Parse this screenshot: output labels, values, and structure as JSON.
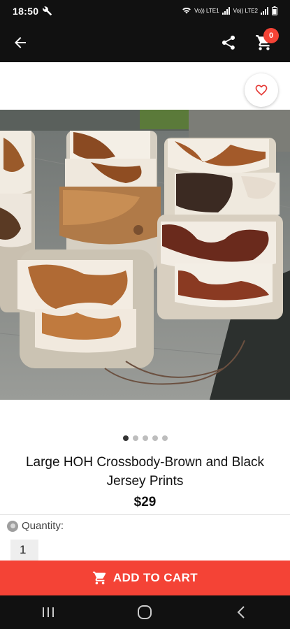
{
  "status_bar": {
    "time": "18:50",
    "signal_label_1": "Vo)) LTE1",
    "signal_label_2": "Vo)) LTE2",
    "icons": [
      "wrench-icon",
      "wifi-icon",
      "signal-icon",
      "battery-icon"
    ]
  },
  "app_bar": {
    "cart_count": "0",
    "icons": [
      "arrow-back-icon",
      "share-icon",
      "cart-icon"
    ]
  },
  "product": {
    "title": "Large HOH Crossbody-Brown and Black Jersey Prints",
    "price": "$29",
    "image_count": 5,
    "active_image_index": 0
  },
  "quantity": {
    "label": "Quantity:",
    "value": "1"
  },
  "actions": {
    "add_to_cart_label": "ADD TO CART"
  },
  "colors": {
    "accent": "#f44336",
    "bar": "#111111"
  }
}
